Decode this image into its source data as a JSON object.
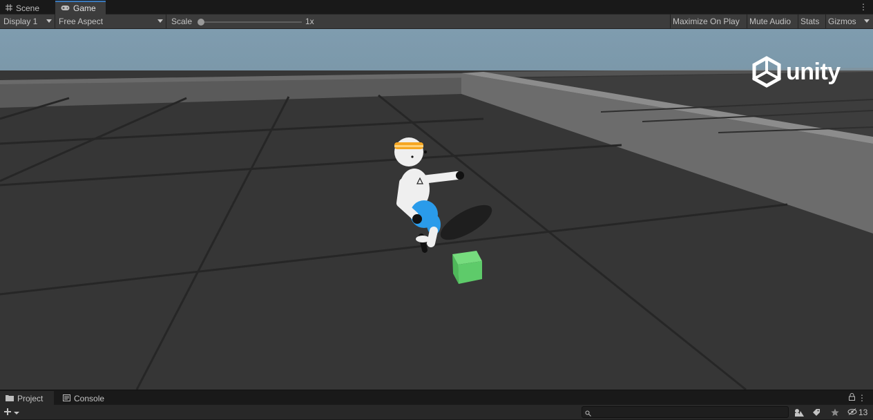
{
  "tabs": {
    "scene_label": "Scene",
    "game_label": "Game"
  },
  "toolbar": {
    "display_value": "Display 1",
    "aspect_value": "Free Aspect",
    "scale_label": "Scale",
    "scale_value": "1x",
    "maximize_label": "Maximize On Play",
    "mute_label": "Mute Audio",
    "stats_label": "Stats",
    "gizmos_label": "Gizmos"
  },
  "viewport": {
    "logo_text": "unity",
    "colors": {
      "sky": "#7c99ab",
      "floor": "#363636",
      "wall": "#6c6c6c",
      "cube": "#5ecb6a",
      "shorts": "#2a9bea",
      "headband": "#f5a623"
    }
  },
  "bottom_tabs": {
    "project_label": "Project",
    "console_label": "Console"
  },
  "bottom_bar": {
    "search_placeholder": "",
    "hidden_count": "13"
  },
  "icons": [
    "grid-icon",
    "gamepad-icon",
    "kebab-menu-icon",
    "folder-icon",
    "console-icon",
    "lock-icon",
    "plus-icon",
    "search-icon",
    "filter-by-type-icon",
    "filter-by-label-icon",
    "favorites-star-icon",
    "hidden-packages-eye-icon",
    "unity-logo-icon"
  ]
}
